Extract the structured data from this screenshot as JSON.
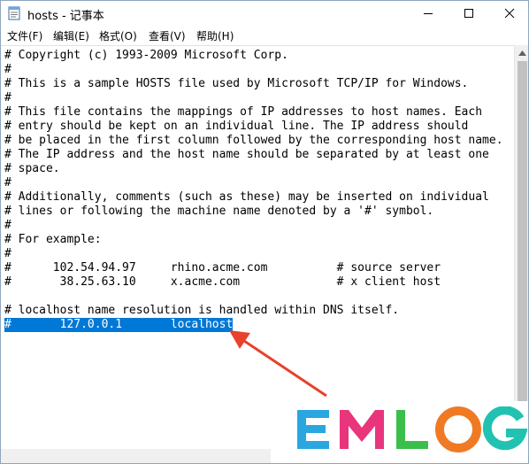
{
  "window": {
    "title": "hosts - 记事本",
    "controls": {
      "minimize": "minimize-icon",
      "maximize": "maximize-icon",
      "close": "close-icon"
    }
  },
  "menu": [
    "文件(F)",
    "编辑(E)",
    "格式(O)",
    "查看(V)",
    "帮助(H)"
  ],
  "lines": [
    "# Copyright (c) 1993-2009 Microsoft Corp.",
    "#",
    "# This is a sample HOSTS file used by Microsoft TCP/IP for Windows.",
    "#",
    "# This file contains the mappings of IP addresses to host names. Each",
    "# entry should be kept on an individual line. The IP address should",
    "# be placed in the first column followed by the corresponding host name.",
    "# The IP address and the host name should be separated by at least one",
    "# space.",
    "#",
    "# Additionally, comments (such as these) may be inserted on individual",
    "# lines or following the machine name denoted by a '#' symbol.",
    "#",
    "# For example:",
    "#",
    "#      102.54.94.97     rhino.acme.com          # source server",
    "#       38.25.63.10     x.acme.com              # x client host",
    "",
    "# localhost name resolution is handled within DNS itself.",
    "#\t127.0.0.1       localhost"
  ],
  "selected_line": "#       127.0.0.1       localhost",
  "colors": {
    "selection": "#0078d7",
    "annotation_arrow": "#e8412c",
    "logo_blue": "#2aa6e0",
    "logo_pink": "#e8357c",
    "logo_green": "#3bbf4a",
    "logo_orange": "#f07a24",
    "logo_teal": "#22c2b2"
  },
  "logo": {
    "letters": [
      "E",
      "M",
      "L",
      "O",
      "G"
    ]
  }
}
